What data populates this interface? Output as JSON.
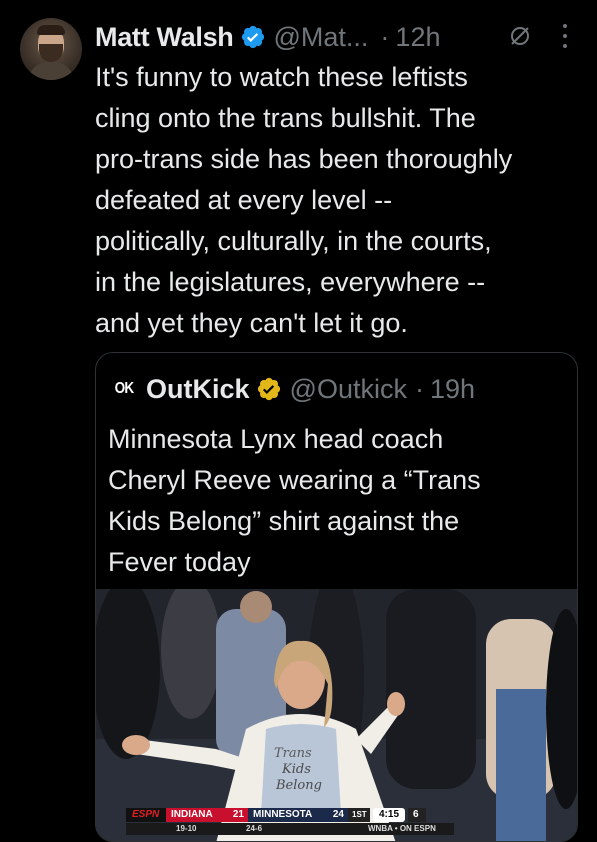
{
  "tweet": {
    "author_name": "Matt Walsh",
    "author_handle": "@Mat...",
    "separator": "·",
    "time": "12h",
    "text": "It's funny to watch these leftists\ncling onto the trans bullshit. The\npro-trans side has been thoroughly\ndefeated at every level --\npolitically, culturally, in the courts,\nin the legislatures, everywhere --\nand yet they can't let it go.",
    "badge_color": "#1d9bf0"
  },
  "quote": {
    "logo_text": "OK",
    "author_name": "OutKick",
    "author_handle": "@Outkick",
    "separator": "·",
    "time": "19h",
    "text": "Minnesota Lynx head coach\nCheryl Reeve wearing a “Trans\nKids Belong” shirt against the\nFever today",
    "badge_color": "#e2b719",
    "media": {
      "shirt_text": "Trans\nKids\nBelong",
      "scorebug": {
        "network": "ESPN",
        "team1": "INDIANA",
        "score1": "21",
        "team2": "MINNESOTA",
        "score2": "24",
        "quarter": "1ST",
        "clock": "4:15",
        "shot_clock": "6",
        "team1_record": "19-10",
        "team2_record": "24-6",
        "broadcast": "WNBA • ON ESPN"
      }
    }
  },
  "icons": {
    "verified": "verified-badge-icon",
    "grok": "grok-icon",
    "more": "more-icon"
  }
}
